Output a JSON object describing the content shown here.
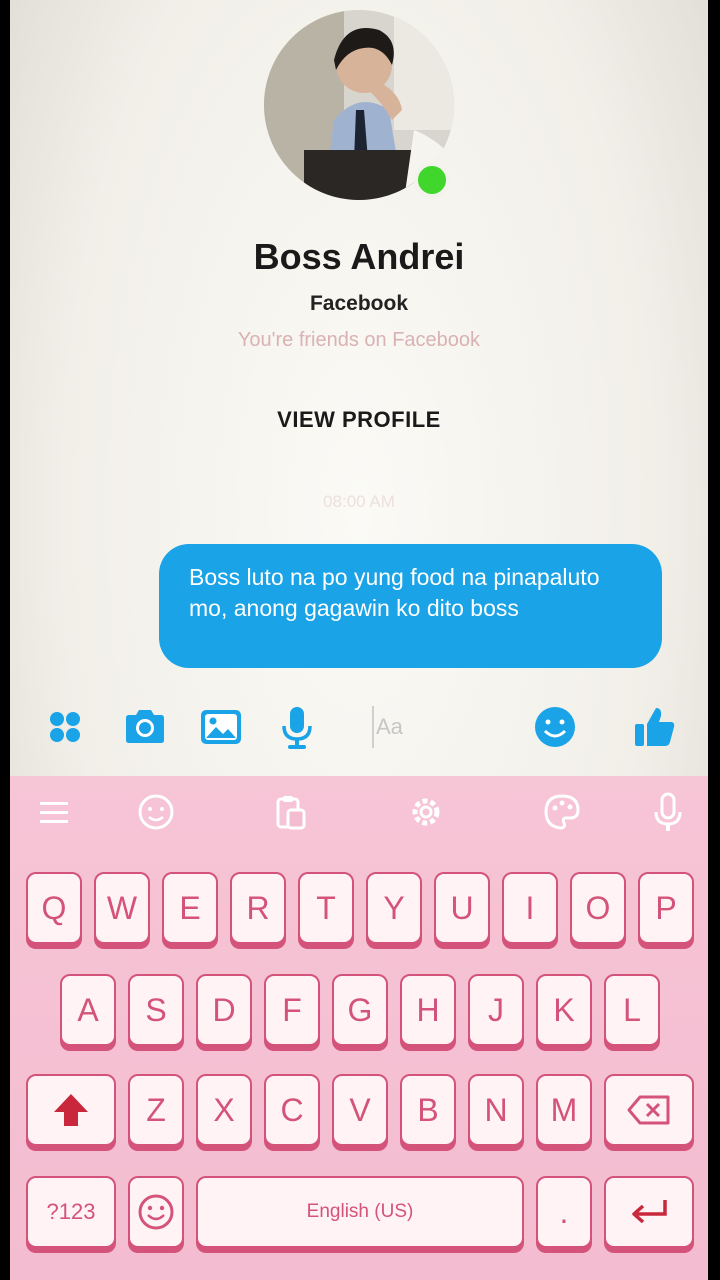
{
  "contact": {
    "name": "Boss Andrei",
    "source": "Facebook",
    "relation": "You're friends on Facebook",
    "view_profile": "VIEW PROFILE",
    "status_color": "#40d62b"
  },
  "conversation": {
    "timestamp": "08:00 AM",
    "messages": [
      {
        "from": "me",
        "text": "Boss luto na po yung food na pinapaluto mo, anong gagawin  ko dito boss"
      }
    ]
  },
  "composer": {
    "placeholder": "Aa",
    "icons": [
      "apps-icon",
      "camera-icon",
      "gallery-icon",
      "microphone-icon",
      "emoji-icon",
      "thumbs-up-icon"
    ],
    "accent": "#1aa3e6"
  },
  "keyboard": {
    "theme_color": "#f4bcd0",
    "key_color": "#d4537a",
    "toolbar": [
      "menu-icon",
      "sticker-icon",
      "clipboard-icon",
      "settings-icon",
      "theme-icon",
      "microphone-icon"
    ],
    "rows": [
      [
        "Q",
        "W",
        "E",
        "R",
        "T",
        "Y",
        "U",
        "I",
        "O",
        "P"
      ],
      [
        "A",
        "S",
        "D",
        "F",
        "G",
        "H",
        "J",
        "K",
        "L"
      ],
      [
        "Z",
        "X",
        "C",
        "V",
        "B",
        "N",
        "M"
      ]
    ],
    "symbols_label": "?123",
    "space_label": "English (US)",
    "period_label": "."
  }
}
